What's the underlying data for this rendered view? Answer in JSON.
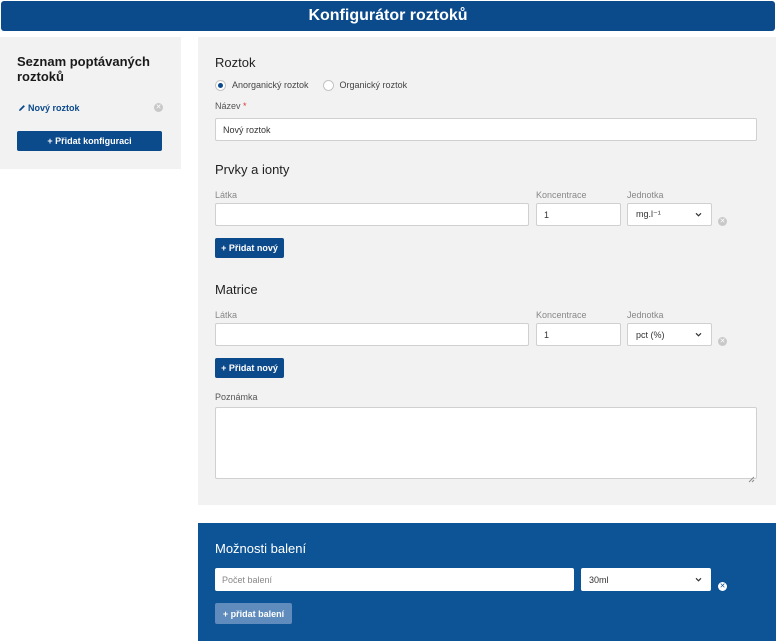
{
  "header": {
    "title": "Konfigurátor roztoků"
  },
  "sidebar": {
    "title": "Seznam poptávaných roztoků",
    "items": [
      {
        "label": "Nový roztok",
        "icon": "pencil-icon"
      }
    ],
    "add_button": "+ Přidat konfiguraci"
  },
  "main": {
    "solution": {
      "title": "Roztok",
      "types": [
        {
          "label": "Anorganický roztok",
          "checked": true
        },
        {
          "label": "Organický roztok",
          "checked": false
        }
      ],
      "name_label": "Název",
      "name_required": "*",
      "name_value": "Nový roztok"
    },
    "elements": {
      "title": "Prvky a ionty",
      "col_substance": "Látka",
      "col_concentration": "Koncentrace",
      "col_unit": "Jednotka",
      "row": {
        "substance": "",
        "concentration": "1",
        "unit": "mg.l⁻¹"
      },
      "add_button": "+ Přidat nový"
    },
    "matrix": {
      "title": "Matrice",
      "col_substance": "Látka",
      "col_concentration": "Koncentrace",
      "col_unit": "Jednotka",
      "row": {
        "substance": "",
        "concentration": "1",
        "unit": "pct (%)"
      },
      "add_button": "+ Přidat nový"
    },
    "note": {
      "label": "Poznámka",
      "value": ""
    }
  },
  "packaging": {
    "title": "Možnosti balení",
    "count_placeholder": "Počet balení",
    "size_value": "30ml",
    "add_button": "+ přidat balení"
  },
  "colors": {
    "primary": "#0b4a8b",
    "packaging_bg": "#0d5497",
    "panel_bg": "#f2f2f2"
  }
}
